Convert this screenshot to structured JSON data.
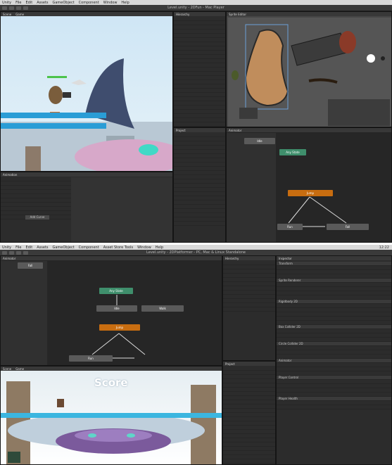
{
  "top": {
    "menu": [
      "Unity",
      "File",
      "Edit",
      "Assets",
      "GameObject",
      "Component",
      "Window",
      "Help"
    ],
    "title": "Level.unity - 2DFun - Mac Player",
    "panels": {
      "scene_tab": "Scene",
      "game_tab": "Game",
      "hierarchy_tab": "Hierarchy",
      "sprite_tab": "Sprite Editor",
      "animation_tab": "Animation",
      "project_tab": "Project",
      "animator_tab": "Animator"
    },
    "animator": {
      "node_any": "Any State",
      "node_entry": "Idle",
      "node_main": "Jump",
      "node_a": "Run",
      "node_b": "Fall"
    },
    "anim_add_curve": "Add Curve"
  },
  "bottom": {
    "menu": [
      "Unity",
      "File",
      "Edit",
      "Assets",
      "GameObject",
      "Component",
      "Asset Store Tools",
      "Window",
      "Help"
    ],
    "title": "Level.unity - 2DPlatformer - PC, Mac & Linux Standalone",
    "clock": "12:22",
    "panels": {
      "animator_tab": "Animator",
      "scene_tab": "Scene",
      "game_tab": "Game",
      "hierarchy_tab": "Hierarchy",
      "project_tab": "Project",
      "inspector_tab": "Inspector"
    },
    "animator": {
      "node_any": "Any State",
      "node_idle": "Idle",
      "node_fall": "Fall",
      "node_main": "Jump",
      "node_a": "Run",
      "node_b": "Walk"
    },
    "game": {
      "score": "Score"
    },
    "inspector_sections": [
      "Transform",
      "Sprite Renderer",
      "Rigidbody 2D",
      "Box Collider 2D",
      "Circle Collider 2D",
      "Animator",
      "Player Control",
      "Player Health"
    ]
  }
}
